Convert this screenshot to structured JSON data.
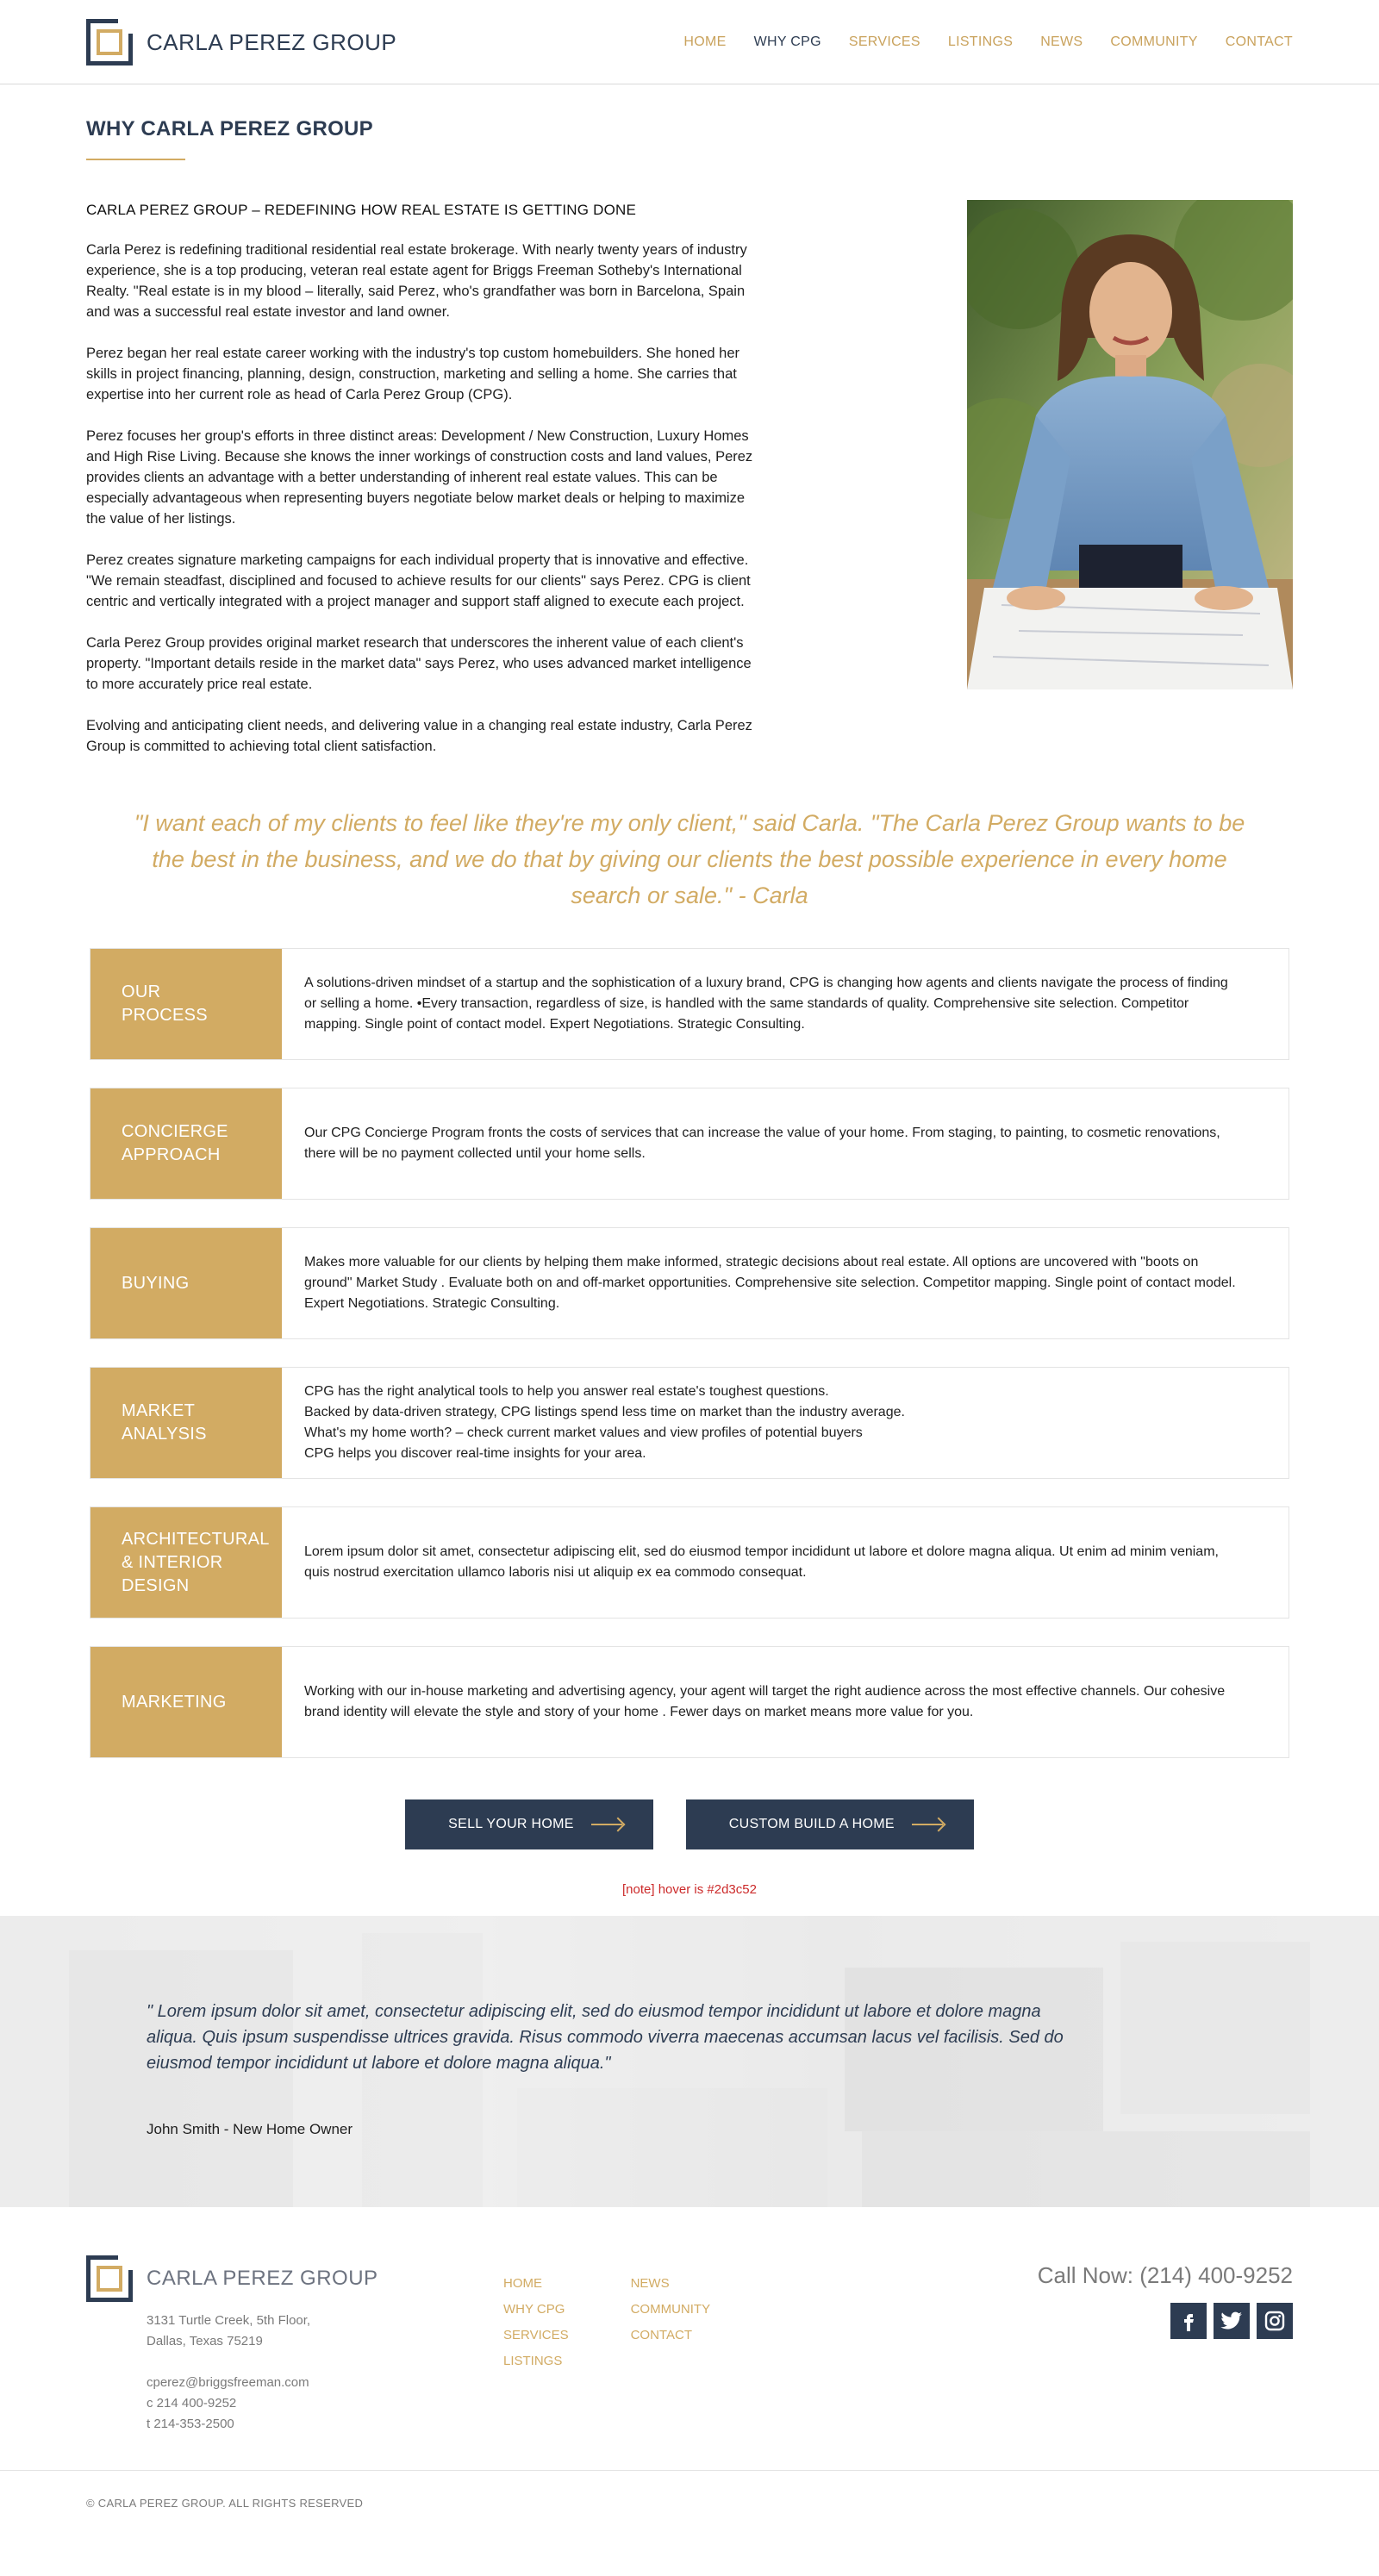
{
  "header": {
    "brand": "CARLA PEREZ GROUP",
    "nav": [
      {
        "label": "HOME"
      },
      {
        "label": "WHY CPG"
      },
      {
        "label": "SERVICES"
      },
      {
        "label": "LISTINGS"
      },
      {
        "label": "NEWS"
      },
      {
        "label": "COMMUNITY"
      },
      {
        "label": "CONTACT"
      }
    ],
    "active_nav": "WHY CPG"
  },
  "page": {
    "title": "WHY CARLA PEREZ GROUP"
  },
  "intro": {
    "heading": "CARLA PEREZ GROUP – REDEFINING HOW REAL ESTATE IS GETTING DONE",
    "paragraphs": [
      "Carla Perez is redefining traditional residential real estate brokerage. With nearly twenty years of industry experience, she is a top producing, veteran real estate agent for Briggs Freeman Sotheby's International Realty. \"Real estate is in my blood – literally, said Perez, who's grandfather was born in Barcelona, Spain and was a successful real estate investor and land owner.",
      "Perez began her real estate career working with the industry's top custom homebuilders. She honed her skills in project financing, planning, design, construction, marketing and selling a home. She carries that expertise into her current role as head of Carla Perez Group (CPG).",
      "Perez focuses her group's efforts in three distinct areas: Development / New Construction, Luxury Homes and High Rise Living.  Because she knows the inner workings of construction costs and land values, Perez provides clients an advantage with a better understanding of inherent real estate values. This can be especially advantageous when representing buyers negotiate below market deals or helping to maximize the value of her listings.",
      "Perez creates signature marketing campaigns for each individual property that  is innovative and effective. \"We remain steadfast, disciplined and focused to achieve results for our clients\" says Perez.  CPG is client centric and vertically integrated with a project manager and support staff aligned to execute each project.",
      "Carla Perez Group provides original market research that underscores the inherent value of each client's property. \"Important details reside in the market data\" says Perez, who uses advanced market intelligence to more accurately price real estate.",
      "Evolving and anticipating client needs, and delivering value in a changing real estate industry, Carla Perez Group is committed to achieving total client satisfaction."
    ]
  },
  "quote": {
    "text": "\"I want each of my clients to feel like they're my only client,\" said Carla. \"The Carla Perez Group wants to be the best in the business, and we do that by giving our clients the best possible experience in every home search or sale.\"  - Carla"
  },
  "features": [
    {
      "label": "OUR PROCESS",
      "text": "A solutions-driven mindset of a startup and the sophistication of a luxury brand, CPG is changing how agents and clients navigate the process of finding or selling a home. •Every transaction, regardless of size, is handled with the same standards of quality. Comprehensive site selection.  Competitor mapping. Single point of contact model. Expert Negotiations. Strategic Consulting."
    },
    {
      "label": "CONCIERGE APPROACH",
      "text": "Our CPG Concierge Program fronts the costs of services that can increase the value of your home. From staging, to painting, to cosmetic renovations, there will be no payment collected until your home sells."
    },
    {
      "label": "BUYING",
      "text": "Makes more valuable for our clients by helping them make informed, strategic decisions about real estate. All options are uncovered with \"boots on ground\" Market Study . Evaluate both on and off-market opportunities. Comprehensive site selection.  Competitor mapping. Single point of contact model. Expert Negotiations. Strategic Consulting."
    },
    {
      "label": "MARKET ANALYSIS",
      "text": "CPG has the right analytical tools to help you answer real estate's toughest questions.\nBacked by data-driven strategy, CPG listings spend less time on market than the industry average.\nWhat's my home worth? – check current market values and view profiles of potential buyers\nCPG helps you discover real-time insights for your area."
    },
    {
      "label": "ARCHITECTURAL & INTERIOR DESIGN",
      "text": "Lorem ipsum dolor sit amet, consectetur adipiscing elit, sed do eiusmod tempor incididunt ut labore et dolore magna aliqua. Ut enim ad minim veniam, quis nostrud exercitation ullamco laboris nisi ut aliquip ex ea commodo consequat."
    },
    {
      "label": "MARKETING",
      "text": "Working with our in-house marketing and advertising agency, your agent will target the right audience across the most effective channels. Our cohesive brand identity will elevate the style and story of your home . Fewer days on market means more value for you."
    }
  ],
  "cta": {
    "sell": "SELL YOUR HOME",
    "build": "CUSTOM BUILD A HOME",
    "note": "[note] hover is #2d3c52"
  },
  "testimonial": {
    "quote": "\" Lorem ipsum dolor sit amet, consectetur adipiscing elit, sed do eiusmod tempor incididunt ut labore et dolore magna aliqua. Quis ipsum suspendisse ultrices gravida. Risus commodo viverra maecenas accumsan lacus vel facilisis. Sed do eiusmod tempor incididunt ut labore et dolore magna aliqua.\"",
    "author": "John Smith - New Home Owner"
  },
  "footer": {
    "brand": "CARLA PEREZ GROUP",
    "address_line1": "3131 Turtle Creek, 5th Floor,",
    "address_line2": "Dallas, Texas  75219",
    "email": "cperez@briggsfreeman.com",
    "cell": "c 214 400-9252",
    "tel": "t 214-353-2500",
    "nav_col1": [
      "HOME",
      "WHY CPG",
      "SERVICES",
      "LISTINGS"
    ],
    "nav_col2": [
      "NEWS",
      "COMMUNITY",
      "CONTACT"
    ],
    "phone": "Call Now: (214) 400-9252",
    "social": [
      "facebook-icon",
      "twitter-icon",
      "instagram-icon"
    ],
    "copyright": "© CARLA PEREZ GROUP. ALL RIGHTS RESERVED"
  },
  "colors": {
    "gold": "#d2ab63",
    "navy": "#2d3c52",
    "note_red": "#cc2a2a"
  }
}
